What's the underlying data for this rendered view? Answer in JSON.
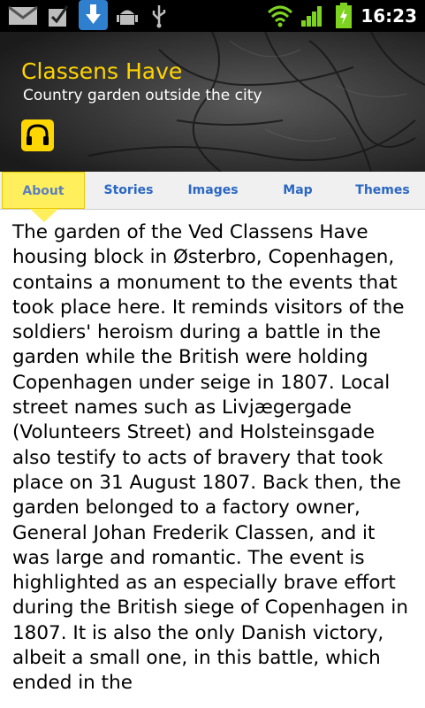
{
  "statusbar": {
    "time": "16:23",
    "icons": [
      "gmail-icon",
      "checkbox-icon",
      "download-icon",
      "android-icon",
      "usb-icon",
      "wifi-icon",
      "signal-icon",
      "battery-charging-icon"
    ]
  },
  "header": {
    "title": "Classens Have",
    "subtitle": "Country garden outside the city",
    "audio_icon": "headphones-icon",
    "accent": "#ffd400"
  },
  "tabs": [
    {
      "label": "About",
      "active": true
    },
    {
      "label": "Stories",
      "active": false
    },
    {
      "label": "Images",
      "active": false
    },
    {
      "label": "Map",
      "active": false
    },
    {
      "label": "Themes",
      "active": false
    }
  ],
  "content": {
    "body": "The garden of the Ved Classens Have housing block in Østerbro, Copenhagen, contains a monument to the events that took place here. It reminds visitors of the soldiers' heroism during a battle in the garden while the British were holding Copenhagen under seige in 1807. Local street names such as Livjægergade (Volunteers Street) and Holsteinsgade also testify to acts of bravery that took place on 31 August 1807. Back then, the garden belonged to a factory owner, General Johan Frederik Classen, and it was large and romantic. The event is highlighted as an especially brave effort during the British siege of Copenhagen in 1807. It is also the only Danish victory, albeit a small one, in this battle, which ended in the"
  }
}
